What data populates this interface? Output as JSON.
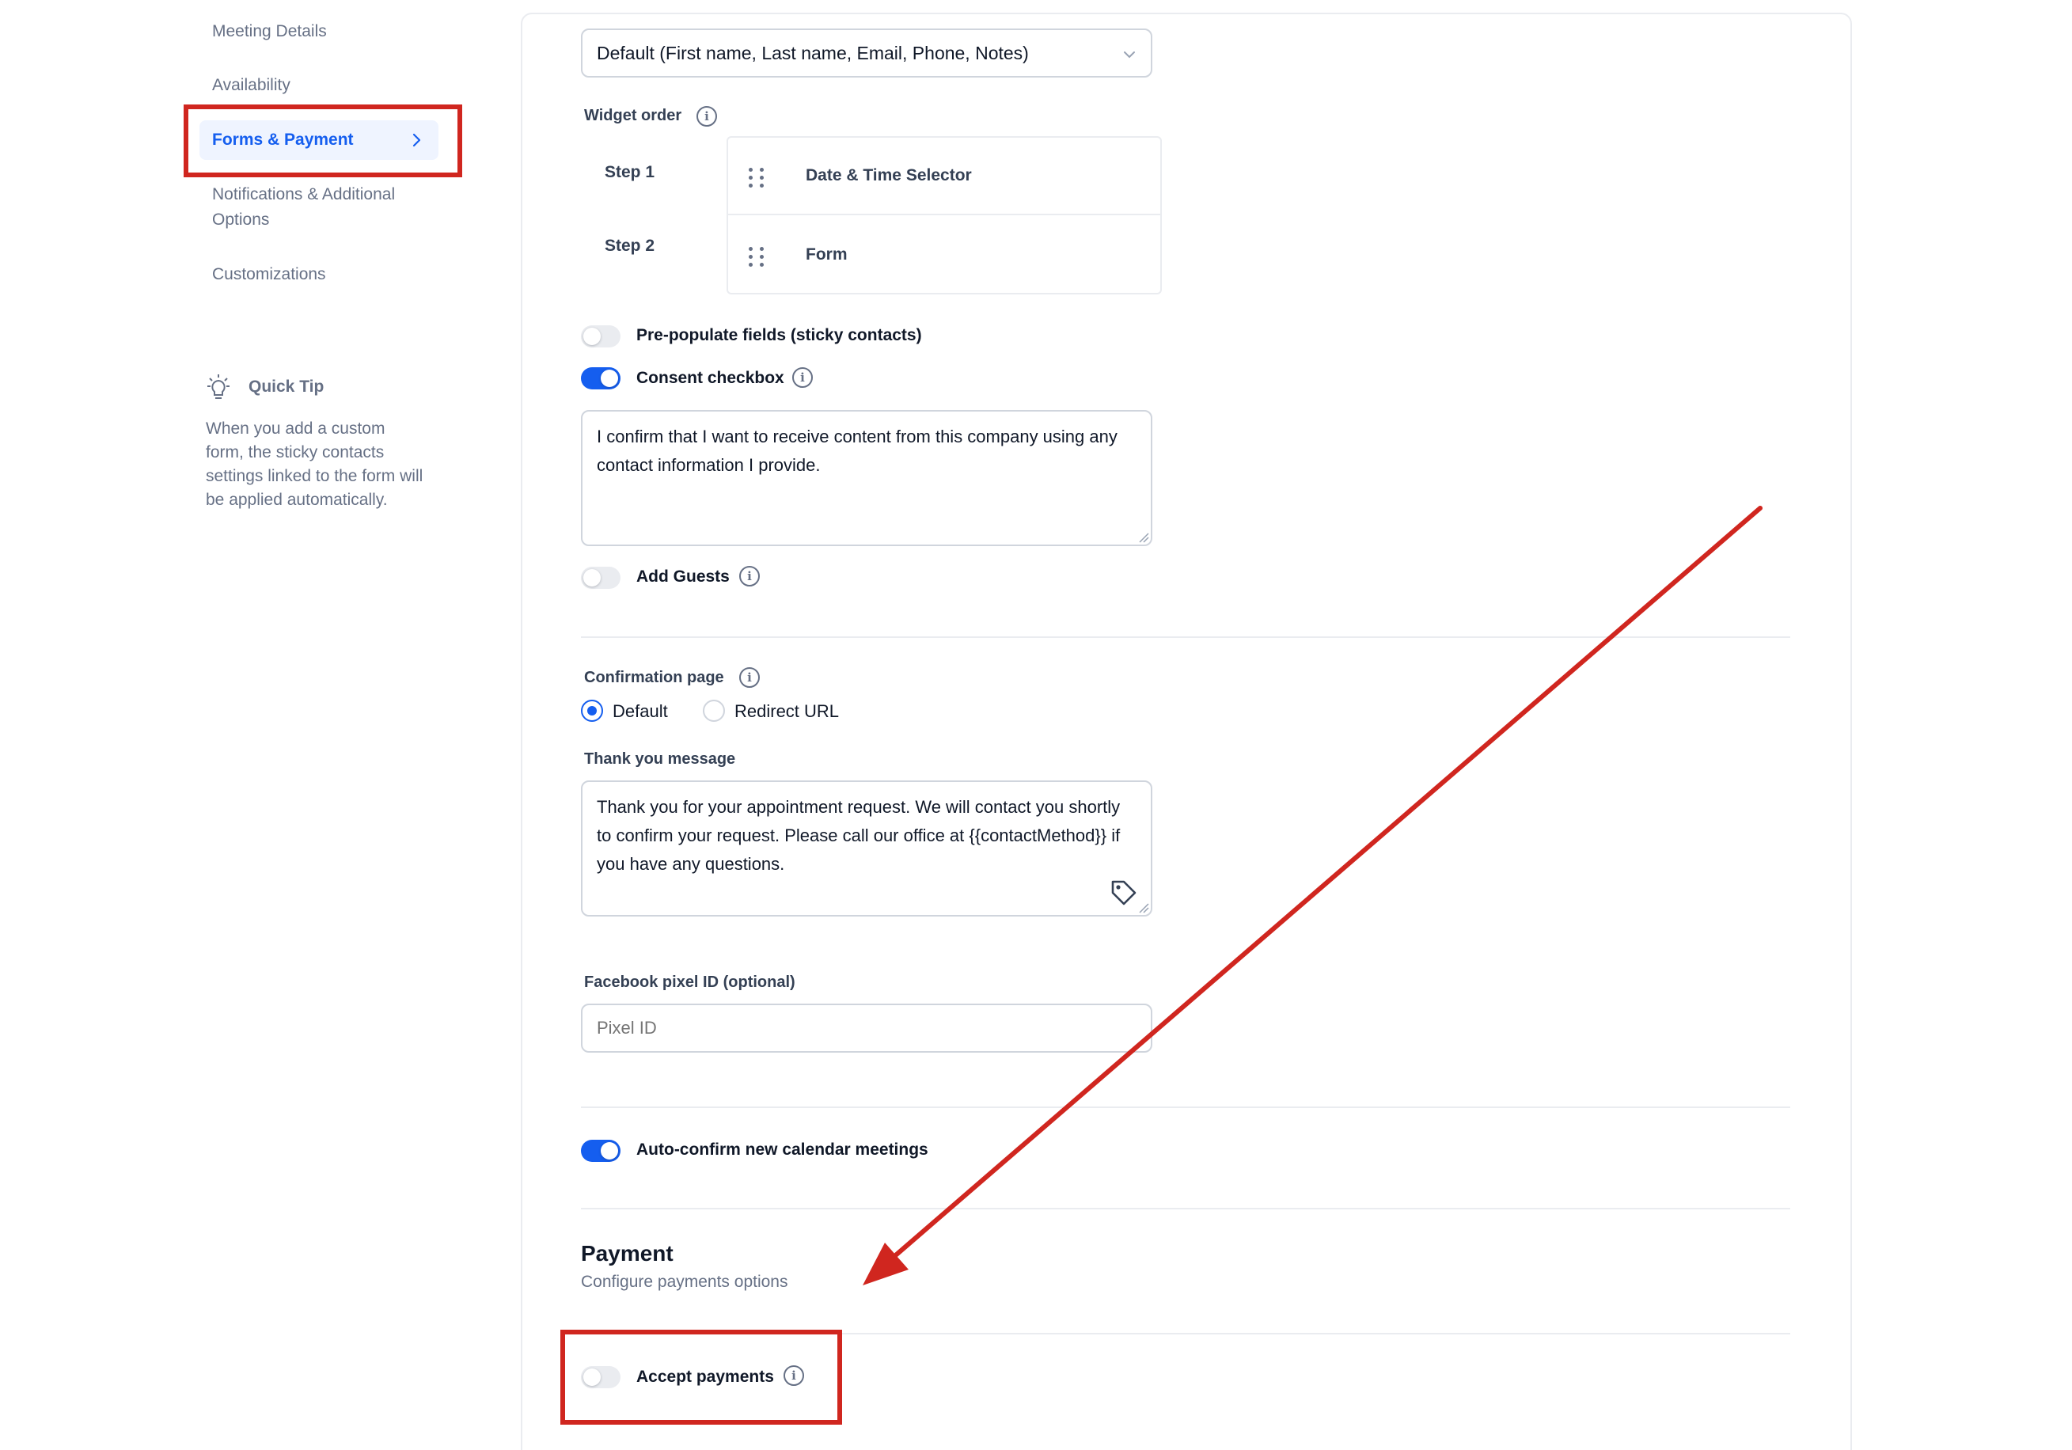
{
  "sidebar": {
    "items": [
      {
        "label": "Meeting Details"
      },
      {
        "label": "Availability"
      },
      {
        "label": "Forms & Payment"
      },
      {
        "label": "Notifications & Additional Options"
      },
      {
        "label": "Customizations"
      }
    ],
    "tip": {
      "title": "Quick Tip",
      "text": "When you add a custom form, the sticky contacts settings linked to the form will be applied automatically."
    }
  },
  "form": {
    "form_select_value": "Default (First name, Last name, Email, Phone, Notes)",
    "widget_order_label": "Widget order",
    "steps": [
      {
        "step": "Step 1",
        "widget": "Date & Time Selector"
      },
      {
        "step": "Step 2",
        "widget": "Form"
      }
    ],
    "prepopulate_label": "Pre-populate fields (sticky contacts)",
    "prepopulate_on": false,
    "consent_label": "Consent checkbox",
    "consent_on": true,
    "consent_text": "I confirm that I want to receive content from this company using any contact information I provide.",
    "add_guests_label": "Add Guests",
    "add_guests_on": false
  },
  "confirmation": {
    "label": "Confirmation page",
    "options": [
      "Default",
      "Redirect URL"
    ],
    "selected": "Default",
    "thankyou_label": "Thank you message",
    "thankyou_text": "Thank you for your appointment request. We will contact you shortly to confirm your request. Please call our office at {{contactMethod}} if you have any questions.",
    "fb_label": "Facebook pixel ID (optional)",
    "fb_placeholder": "Pixel ID",
    "autoconfirm_label": "Auto-confirm new calendar meetings",
    "autoconfirm_on": true
  },
  "payment": {
    "title": "Payment",
    "subtitle": "Configure payments options",
    "accept_label": "Accept payments",
    "accept_on": false
  },
  "colors": {
    "accent": "#155eef",
    "annotation_red": "#d0261f"
  }
}
